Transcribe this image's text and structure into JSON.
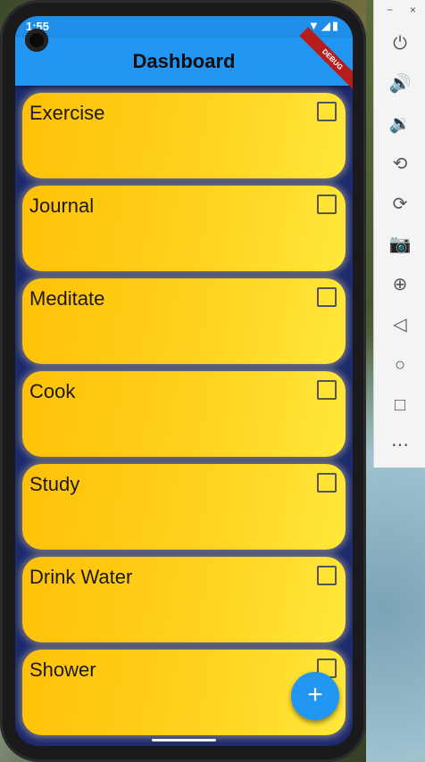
{
  "status_bar": {
    "time": "1:55",
    "icons": "▼◢▮"
  },
  "appbar": {
    "title": "Dashboard",
    "debug_ribbon": "DEBUG"
  },
  "tasks": [
    {
      "label": "Exercise",
      "checked": false
    },
    {
      "label": "Journal",
      "checked": false
    },
    {
      "label": "Meditate",
      "checked": false
    },
    {
      "label": "Cook",
      "checked": false
    },
    {
      "label": "Study",
      "checked": false
    },
    {
      "label": "Drink Water",
      "checked": false
    },
    {
      "label": "Shower",
      "checked": false
    }
  ],
  "fab": {
    "label": "+"
  },
  "emulator_panel": {
    "minimize": "−",
    "close": "×",
    "buttons": [
      {
        "name": "power-icon",
        "glyph": "⏻"
      },
      {
        "name": "volume-up-icon",
        "glyph": "🔊"
      },
      {
        "name": "volume-down-icon",
        "glyph": "🔉"
      },
      {
        "name": "rotate-left-icon",
        "glyph": "⟲"
      },
      {
        "name": "rotate-right-icon",
        "glyph": "⟳"
      },
      {
        "name": "camera-icon",
        "glyph": "📷"
      },
      {
        "name": "zoom-icon",
        "glyph": "⊕"
      },
      {
        "name": "back-icon",
        "glyph": "◁"
      },
      {
        "name": "home-icon",
        "glyph": "○"
      },
      {
        "name": "overview-icon",
        "glyph": "□"
      },
      {
        "name": "more-icon",
        "glyph": "⋯"
      }
    ]
  },
  "colors": {
    "appbar": "#2196f3",
    "card_start": "#ffc107",
    "card_end": "#ffe83a",
    "screen_bg": "#1d2a6e"
  }
}
